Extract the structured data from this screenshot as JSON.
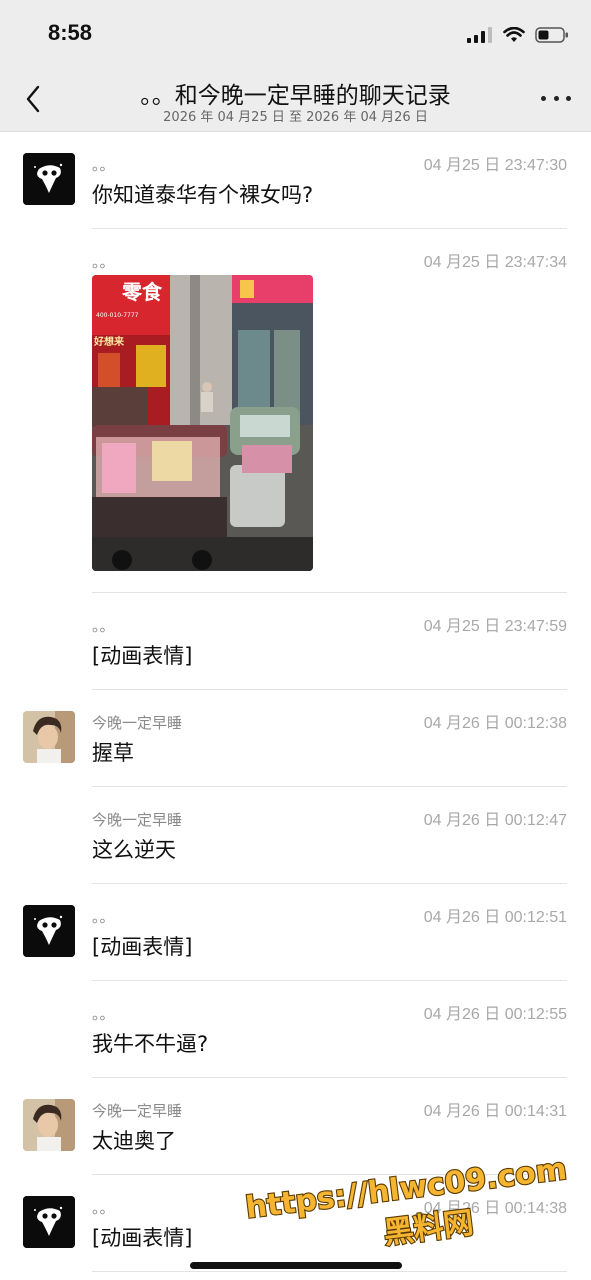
{
  "status_bar": {
    "time": "8:58",
    "icons": [
      "signal-icon",
      "wifi-icon",
      "battery-icon"
    ]
  },
  "header": {
    "title": "。。和今晚一定早睡的聊天记录",
    "subtitle": "2026 年 04 月25 日 至 2026 年 04 月26 日",
    "back_icon": "chevron-left-icon",
    "more_icon": "more-icon"
  },
  "messages": [
    {
      "avatar": "avatar-a",
      "sender": "。。",
      "time": "04 月25 日 23:47:30",
      "text": "你知道泰华有个裸女吗?"
    },
    {
      "avatar": "",
      "sender": "。。",
      "time": "04 月25 日 23:47:34",
      "image": "street-photo"
    },
    {
      "avatar": "",
      "sender": "。。",
      "time": "04 月25 日 23:47:59",
      "text": "[动画表情]"
    },
    {
      "avatar": "avatar-b",
      "sender": "今晚一定早睡",
      "time": "04 月26 日 00:12:38",
      "text": "握草"
    },
    {
      "avatar": "",
      "sender": "今晚一定早睡",
      "time": "04 月26 日 00:12:47",
      "text": "这么逆天"
    },
    {
      "avatar": "avatar-a",
      "sender": "。。",
      "time": "04 月26 日 00:12:51",
      "text": "[动画表情]"
    },
    {
      "avatar": "",
      "sender": "。。",
      "time": "04 月26 日 00:12:55",
      "text": "我牛不牛逼?"
    },
    {
      "avatar": "avatar-b",
      "sender": "今晚一定早睡",
      "time": "04 月26 日 00:14:31",
      "text": "太迪奥了"
    },
    {
      "avatar": "avatar-a",
      "sender": "。。",
      "time": "04 月26 日 00:14:38",
      "text": "[动画表情]"
    }
  ],
  "photo": {
    "shop_sign_1": "零食",
    "shop_sign_2": "好想来",
    "shop_phone": "400-010-7777"
  },
  "watermark": {
    "line1": "https://hlwc09.com",
    "line2": "黑料网"
  },
  "colors": {
    "background": "#ffffff",
    "header_bg": "#ededed",
    "timestamp": "#a8a8a8",
    "sender": "#8a8a8a",
    "watermark_fill": "#f5b531",
    "watermark_stroke": "#5a3a00"
  }
}
